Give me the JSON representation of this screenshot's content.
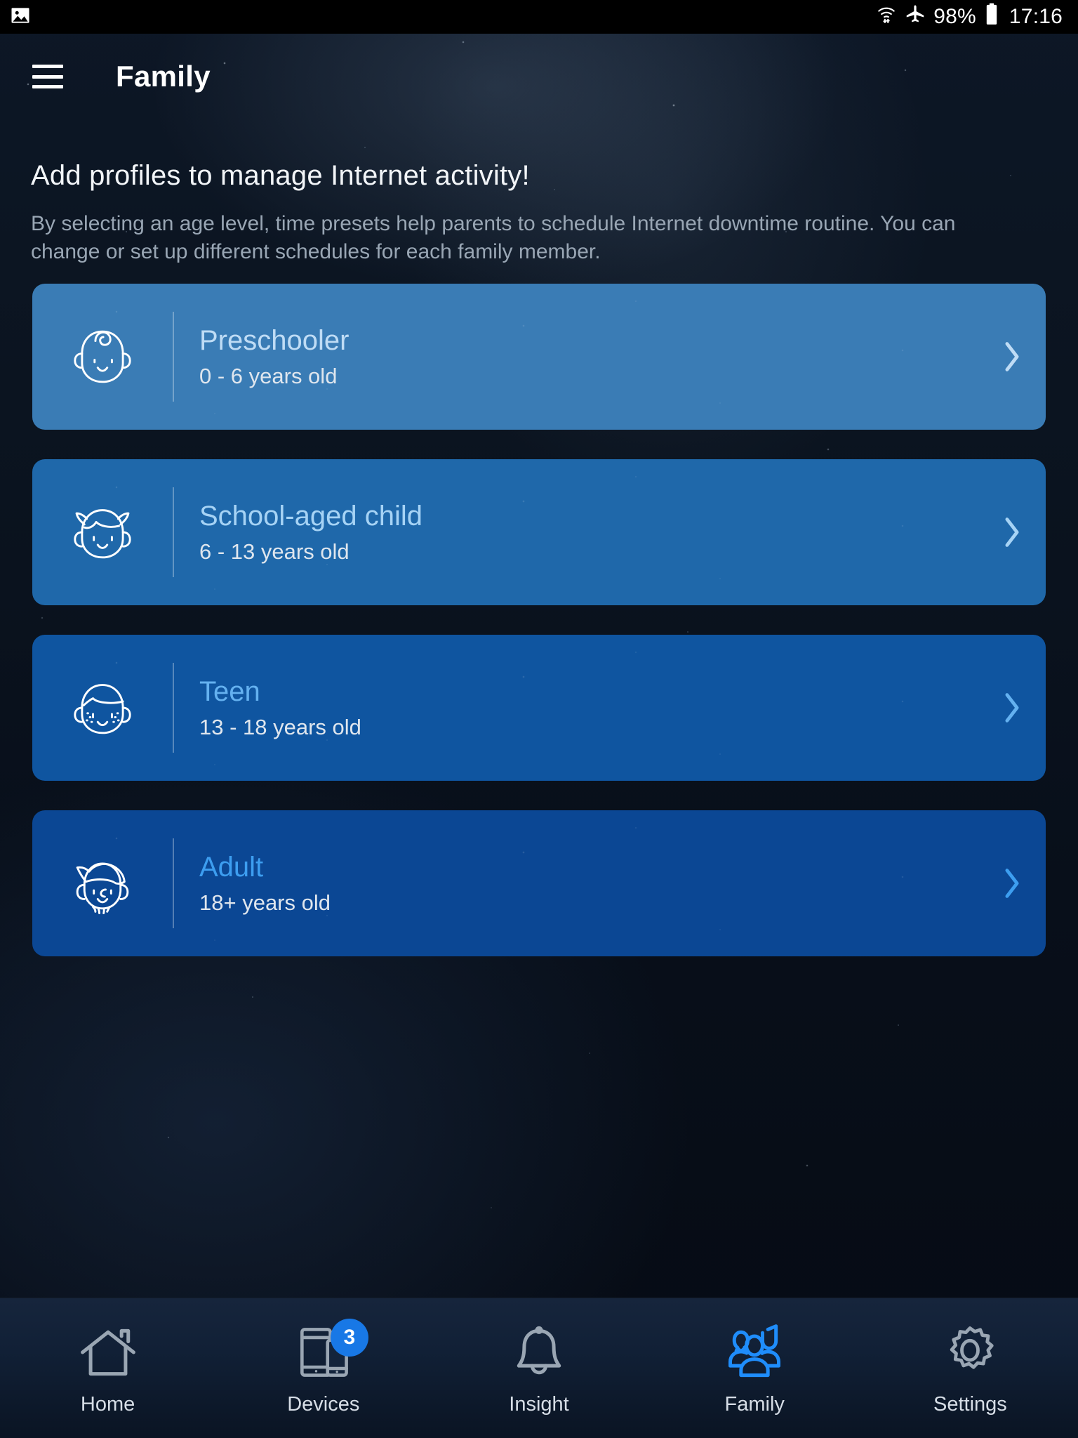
{
  "statusbar": {
    "notification_icon": "image-icon",
    "wifi_icon": "wifi-icon",
    "airplane_icon": "airplane-mode-icon",
    "battery_percent": "98%",
    "battery_icon": "battery-full-icon",
    "time": "17:16"
  },
  "appbar": {
    "menu_icon": "hamburger-menu-icon",
    "title": "Family"
  },
  "intro": {
    "title": "Add profiles to manage Internet activity!",
    "subtitle": "By selecting an age level, time presets help parents to schedule Internet downtime routine. You can change or set up different schedules for each family member."
  },
  "profiles": [
    {
      "name": "Preschooler",
      "age_range": "0 - 6 years old",
      "icon": "baby-face-icon",
      "card_color": "#3a7cb5",
      "title_color": "#bfdcf5",
      "chevron": "chevron-right-icon"
    },
    {
      "name": "School-aged child",
      "age_range": "6 - 13 years old",
      "icon": "girl-face-icon",
      "card_color": "#1f68aa",
      "title_color": "#a6d3f5",
      "chevron": "chevron-right-icon"
    },
    {
      "name": "Teen",
      "age_range": "13 - 18 years old",
      "icon": "teen-face-icon",
      "card_color": "#0f55a0",
      "title_color": "#64b1f0",
      "chevron": "chevron-right-icon"
    },
    {
      "name": "Adult",
      "age_range": "18+ years old",
      "icon": "adult-face-icon",
      "card_color": "#0b4794",
      "title_color": "#3d9ef0",
      "chevron": "chevron-right-icon"
    }
  ],
  "bottom_nav": {
    "active_color": "#1f8dfb",
    "inactive_color": "#9aa6b3",
    "items": [
      {
        "label": "Home",
        "icon": "home-icon",
        "active": false,
        "badge": ""
      },
      {
        "label": "Devices",
        "icon": "devices-icon",
        "active": false,
        "badge": "3"
      },
      {
        "label": "Insight",
        "icon": "bell-icon",
        "active": false,
        "badge": ""
      },
      {
        "label": "Family",
        "icon": "people-group-icon",
        "active": true,
        "badge": ""
      },
      {
        "label": "Settings",
        "icon": "gear-icon",
        "active": false,
        "badge": ""
      }
    ]
  }
}
